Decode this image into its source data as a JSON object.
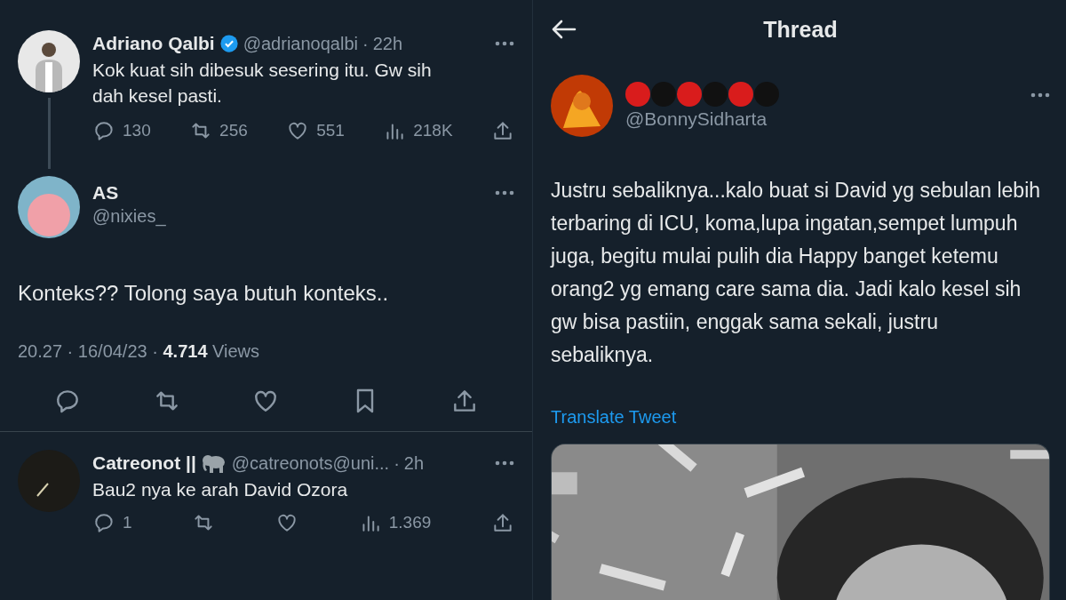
{
  "left": {
    "parent_tweet": {
      "name": "Adriano Qalbi",
      "verified": true,
      "handle": "@adrianoqalbi",
      "sep": "·",
      "time": "22h",
      "text": "Kok kuat sih dibesuk sesering itu. Gw sih dah kesel pasti.",
      "actions": [
        {
          "kind": "reply",
          "count": "130"
        },
        {
          "kind": "retweet",
          "count": "256"
        },
        {
          "kind": "like",
          "count": "551"
        },
        {
          "kind": "views",
          "count": "218K"
        },
        {
          "kind": "share"
        }
      ]
    },
    "main_tweet": {
      "name": "AS",
      "handle": "@nixies_",
      "text": "Konteks?? Tolong saya butuh konteks..",
      "meta": "20.27 · 16/04/23 · **4.714** Views",
      "actions": [
        {
          "kind": "reply"
        },
        {
          "kind": "retweet"
        },
        {
          "kind": "like"
        },
        {
          "kind": "bookmark"
        },
        {
          "kind": "share"
        }
      ]
    },
    "reply": {
      "name": "Catreonot ||",
      "verified": false,
      "handle": "@catreonots@uni...",
      "sep": "·",
      "time": "2h",
      "text": "Bau2 nya ke arah David Ozora",
      "actions": [
        {
          "kind": "reply",
          "count": "1"
        },
        {
          "kind": "retweet"
        },
        {
          "kind": "like"
        },
        {
          "kind": "views",
          "count": "1.369"
        },
        {
          "kind": "share"
        }
      ]
    }
  },
  "right": {
    "header": {
      "title": "Thread"
    },
    "tweet": {
      "name_dots": [
        {
          "color": "#d91c1c"
        },
        {
          "color": "#111111"
        },
        {
          "color": "#d91c1c"
        },
        {
          "color": "#111111"
        },
        {
          "color": "#d91c1c"
        },
        {
          "color": "#111111"
        }
      ],
      "handle": "@BonnySidharta",
      "text": "Justru sebaliknya...kalo buat si David yg sebulan lebih terbaring di ICU, koma,lupa ingatan,sempet lumpuh juga, begitu mulai pulih dia Happy banget ketemu orang2 yg emang care sama dia. Jadi kalo kesel sih gw bisa pastiin, enggak sama sekali, justru sebaliknya.",
      "translate": "Translate Tweet"
    }
  }
}
